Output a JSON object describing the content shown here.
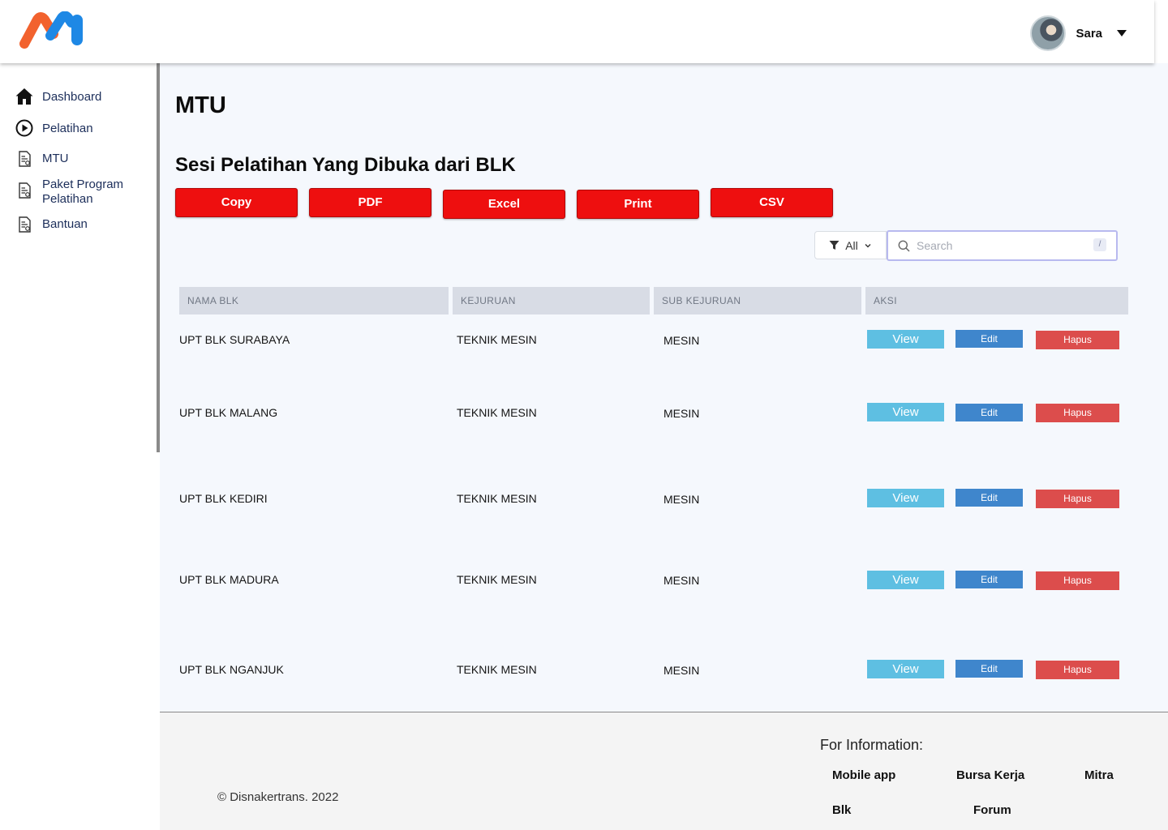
{
  "header": {
    "user_name": "Sara"
  },
  "sidebar": {
    "items": [
      {
        "label": "Dashboard",
        "icon": "home-icon"
      },
      {
        "label": "Pelatihan",
        "icon": "play-circle-icon"
      },
      {
        "label": "MTU",
        "icon": "document-icon"
      },
      {
        "label": "Paket Program Pelatihan",
        "icon": "document-icon"
      },
      {
        "label": "Bantuan",
        "icon": "document-icon"
      }
    ]
  },
  "main": {
    "page_title": "MTU",
    "section_title": "Sesi Pelatihan Yang Dibuka dari BLK",
    "export_buttons": [
      "Copy",
      "PDF",
      "Excel",
      "Print",
      "CSV"
    ],
    "filter_label": "All",
    "search_placeholder": "Search",
    "search_shortcut": "/",
    "table": {
      "headers": [
        "NAMA BLK",
        "KEJURUAN",
        "SUB KEJURUAN",
        "AKSI"
      ],
      "rows": [
        [
          "UPT BLK SURABAYA",
          "TEKNIK MESIN",
          "MESIN"
        ],
        [
          "UPT BLK MALANG",
          "TEKNIK MESIN",
          "MESIN"
        ],
        [
          "UPT BLK KEDIRI",
          "TEKNIK MESIN",
          "MESIN"
        ],
        [
          "UPT BLK MADURA",
          "TEKNIK MESIN",
          "MESIN"
        ],
        [
          "UPT BLK NGANJUK",
          "TEKNIK MESIN",
          "MESIN"
        ]
      ],
      "actions": {
        "view": "View",
        "edit": "Edit",
        "delete": "Hapus"
      }
    }
  },
  "footer": {
    "copyright": "© Disnakertrans. 2022",
    "info_title": "For Information:",
    "links": [
      "Mobile app",
      "Bursa Kerja",
      "Mitra",
      "Blk",
      "Forum"
    ]
  },
  "colors": {
    "export_button": "#ee0f0f",
    "view": "#5ebfe2",
    "edit": "#3f86cc",
    "delete": "#dc4d4c",
    "nav_text": "#1c2e5a"
  }
}
